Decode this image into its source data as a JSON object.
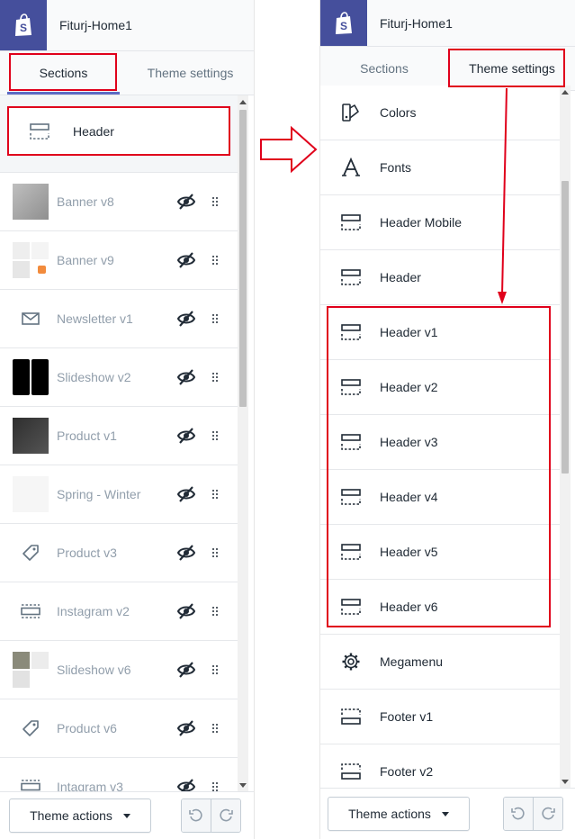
{
  "left": {
    "store_name": "Fiturj-Home1",
    "tabs": [
      {
        "label": "Sections",
        "active": true
      },
      {
        "label": "Theme settings",
        "active": false
      }
    ],
    "header_item": {
      "label": "Header",
      "icon": "header-layout-icon"
    },
    "items": [
      {
        "label": "Banner v8",
        "icon": "image-thumbnail",
        "hidden": true
      },
      {
        "label": "Banner v9",
        "icon": "image-collage-thumbnail",
        "hidden": true
      },
      {
        "label": "Newsletter v1",
        "icon": "envelope-icon",
        "hidden": true
      },
      {
        "label": "Slideshow v2",
        "icon": "slideshow-thumbnail",
        "hidden": true
      },
      {
        "label": "Product v1",
        "icon": "image-thumbnail",
        "hidden": true
      },
      {
        "label": "Spring - Winter",
        "icon": "blank-thumbnail",
        "hidden": true
      },
      {
        "label": "Product v3",
        "icon": "tag-icon",
        "hidden": true
      },
      {
        "label": "Instagram v2",
        "icon": "section-layout-icon",
        "hidden": true
      },
      {
        "label": "Slideshow v6",
        "icon": "image-collage-thumbnail",
        "hidden": true
      },
      {
        "label": "Product v6",
        "icon": "tag-icon",
        "hidden": true
      },
      {
        "label": "Intagram v3",
        "icon": "section-layout-icon",
        "hidden": true
      }
    ],
    "footer": {
      "theme_actions_label": "Theme actions"
    }
  },
  "right": {
    "store_name": "Fiturj-Home1",
    "tabs": [
      {
        "label": "Sections",
        "active": false
      },
      {
        "label": "Theme settings",
        "active": true
      }
    ],
    "items": [
      {
        "label": "Colors",
        "icon": "paint-brush-icon"
      },
      {
        "label": "Fonts",
        "icon": "font-icon"
      },
      {
        "label": "Header Mobile",
        "icon": "header-layout-icon"
      },
      {
        "label": "Header",
        "icon": "header-layout-icon"
      },
      {
        "label": "Header v1",
        "icon": "header-layout-icon"
      },
      {
        "label": "Header v2",
        "icon": "header-layout-icon"
      },
      {
        "label": "Header v3",
        "icon": "header-layout-icon"
      },
      {
        "label": "Header v4",
        "icon": "header-layout-icon"
      },
      {
        "label": "Header v5",
        "icon": "header-layout-icon"
      },
      {
        "label": "Header v6",
        "icon": "header-layout-icon"
      },
      {
        "label": "Megamenu",
        "icon": "gear-icon"
      },
      {
        "label": "Footer v1",
        "icon": "footer-layout-icon"
      },
      {
        "label": "Footer v2",
        "icon": "footer-layout-icon"
      }
    ],
    "footer": {
      "theme_actions_label": "Theme actions"
    }
  },
  "colors": {
    "brand": "#454f9c",
    "accent": "#5c6ac4",
    "annotation": "#e0001b"
  }
}
